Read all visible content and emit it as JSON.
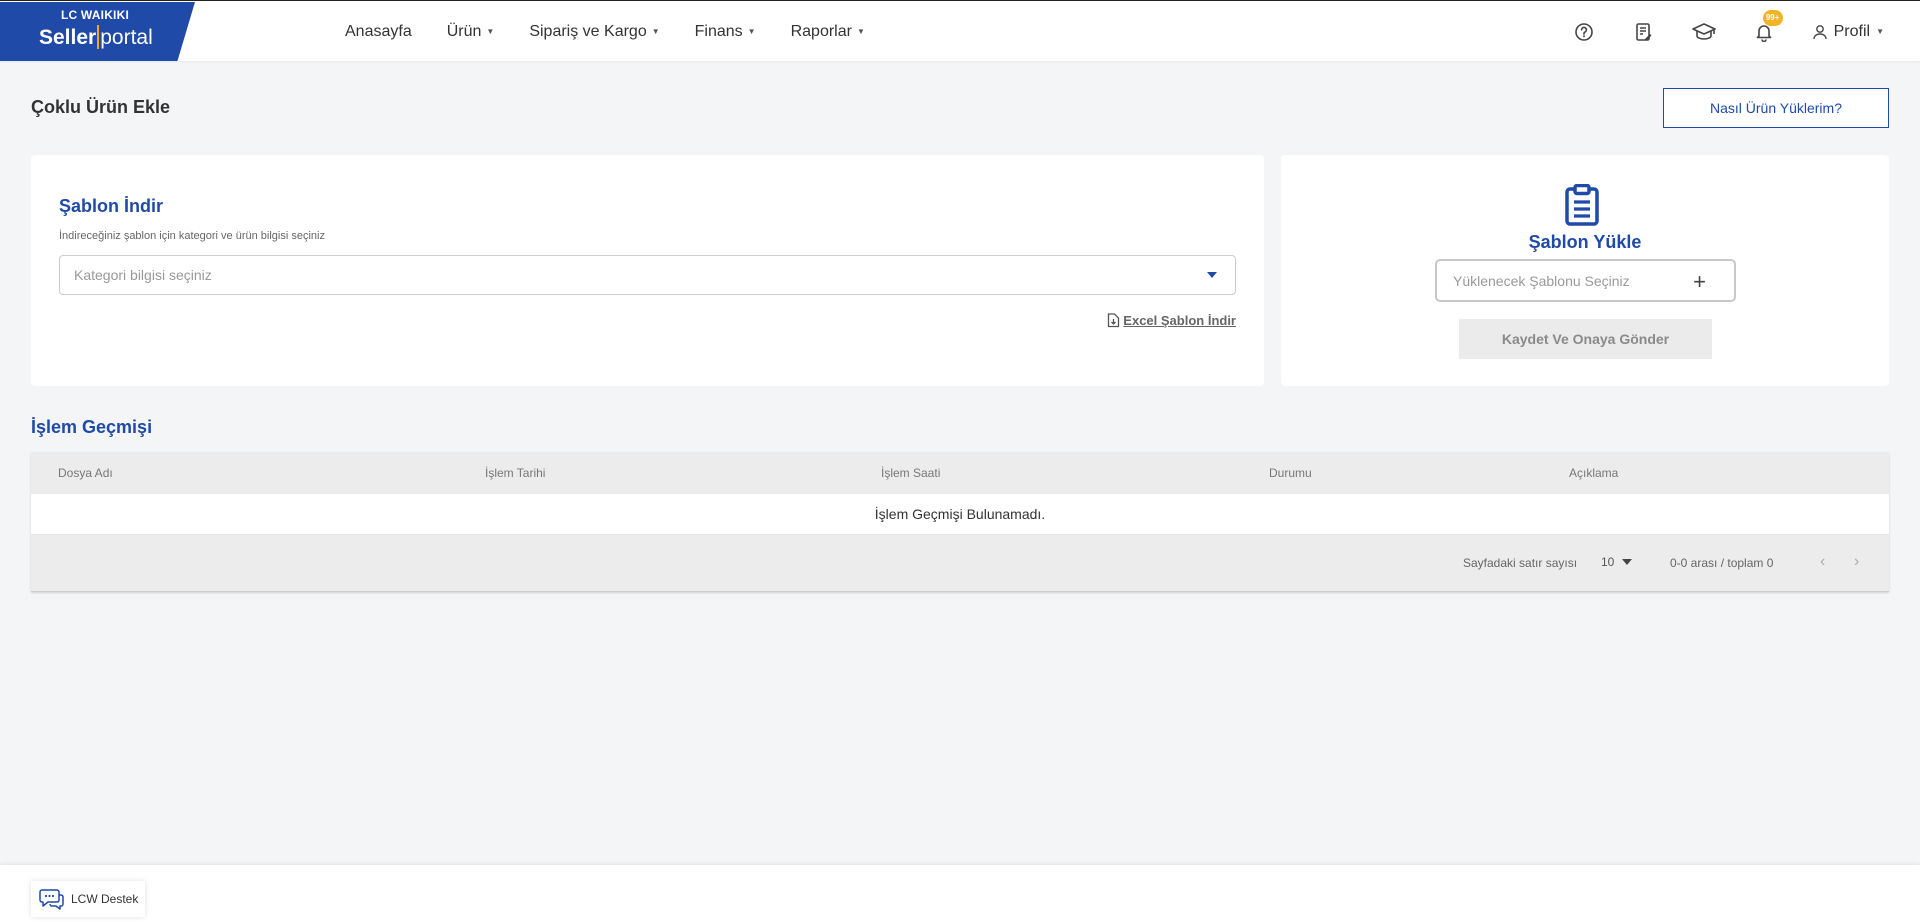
{
  "logo": {
    "brand": "LC WAIKIKI",
    "sub_bold": "Seller",
    "sub_light": "portal"
  },
  "nav": {
    "home": "Anasayfa",
    "product": "Ürün",
    "orders": "Sipariş ve Kargo",
    "finance": "Finans",
    "reports": "Raporlar"
  },
  "header_right": {
    "notification_badge": "99+",
    "profile": "Profil"
  },
  "page": {
    "title": "Çoklu Ürün Ekle",
    "how_button": "Nasıl Ürün Yüklerim?"
  },
  "download": {
    "title": "Şablon İndir",
    "description": "İndireceğiniz şablon için kategori ve ürün bilgisi seçiniz",
    "select_placeholder": "Kategori bilgisi seçiniz",
    "excel_link": "Excel Şablon İndir"
  },
  "upload": {
    "title": "Şablon Yükle",
    "file_placeholder": "Yüklenecek Şablonu Seçiniz",
    "submit": "Kaydet Ve Onaya Gönder"
  },
  "history": {
    "title": "İşlem Geçmişi",
    "columns": [
      "Dosya Adı",
      "İşlem Tarihi",
      "İşlem Saati",
      "Durumu",
      "Açıklama"
    ],
    "empty": "İşlem Geçmişi Bulunamadı.",
    "rows_label": "Sayfadaki satır sayısı",
    "rows_value": "10",
    "range": "0-0 arası / toplam 0"
  },
  "support": {
    "label": "LCW Destek"
  }
}
